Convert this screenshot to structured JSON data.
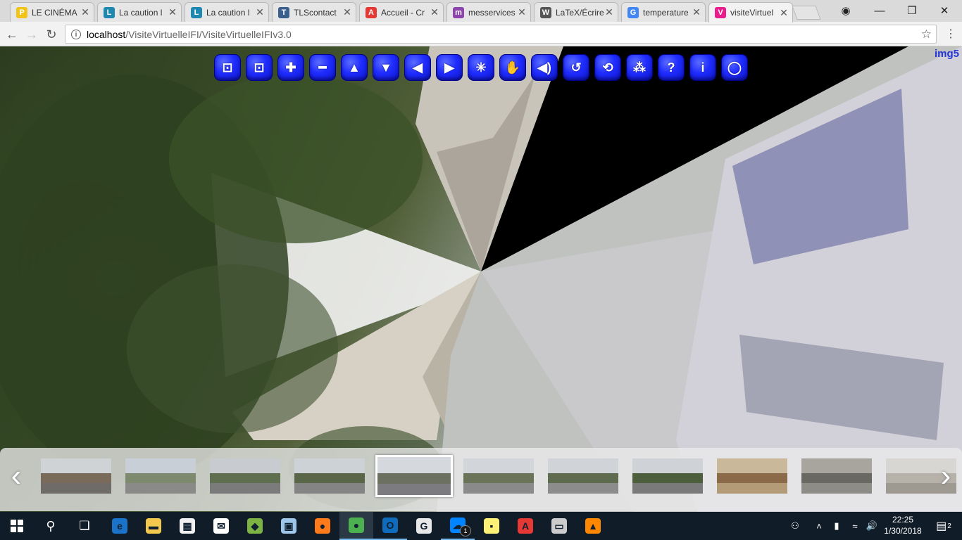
{
  "browser": {
    "tabs": [
      {
        "label": "LE CINÉMA",
        "icon": "p-logo-icon",
        "color": "#f0c419",
        "letter": "P"
      },
      {
        "label": "La caution l",
        "icon": "puzzle-icon",
        "color": "#1e88b0",
        "letter": "L"
      },
      {
        "label": "La caution l",
        "icon": "puzzle-icon",
        "color": "#1e88b0",
        "letter": "L"
      },
      {
        "label": "TLScontact",
        "icon": "t-logo-icon",
        "color": "#3a5f8c",
        "letter": "T"
      },
      {
        "label": "Accueil - Cr",
        "icon": "bank-logo-icon",
        "color": "#e53935",
        "letter": "A"
      },
      {
        "label": "messervices",
        "icon": "circles-logo-icon",
        "color": "#8e44ad",
        "letter": "m"
      },
      {
        "label": "LaTeX/Écrire",
        "icon": "book-icon",
        "color": "#555555",
        "letter": "W"
      },
      {
        "label": "temperature",
        "icon": "google-icon",
        "color": "#4285f4",
        "letter": "G"
      },
      {
        "label": "visiteVirtuel",
        "icon": "app-logo-icon",
        "color": "#e91e8c",
        "letter": "V",
        "active": true
      }
    ],
    "url_host": "localhost",
    "url_path": "/VisiteVirtuelleIFI/VisiteVirtuelleIFIv3.0"
  },
  "viewer": {
    "image_name": "img5",
    "controls": [
      {
        "name": "fullscreen-left-icon",
        "glyph": "⊡"
      },
      {
        "name": "fullscreen-right-icon",
        "glyph": "⊡"
      },
      {
        "name": "zoom-in-icon",
        "glyph": "✚"
      },
      {
        "name": "zoom-out-icon",
        "glyph": "━"
      },
      {
        "name": "arrow-up-icon",
        "glyph": "▲"
      },
      {
        "name": "arrow-down-icon",
        "glyph": "▼"
      },
      {
        "name": "arrow-left-icon",
        "glyph": "◀"
      },
      {
        "name": "arrow-right-icon",
        "glyph": "▶"
      },
      {
        "name": "gyroscope-icon",
        "glyph": "✳"
      },
      {
        "name": "hand-icon",
        "glyph": "✋"
      },
      {
        "name": "sound-icon",
        "glyph": "◀)"
      },
      {
        "name": "rotate-icon",
        "glyph": "↺"
      },
      {
        "name": "autorotate-icon",
        "glyph": "⟲"
      },
      {
        "name": "hotspots-icon",
        "glyph": "⁂"
      },
      {
        "name": "help-icon",
        "glyph": "?"
      },
      {
        "name": "info-icon",
        "glyph": "i"
      },
      {
        "name": "vr-icon",
        "glyph": "◯"
      }
    ],
    "thumbnails": [
      {
        "sky": "#cfd3d6",
        "mid": "#7a6a5a",
        "ground": "#6e6b68"
      },
      {
        "sky": "#c9cfd6",
        "mid": "#7e8a6e",
        "ground": "#8a8a88"
      },
      {
        "sky": "#c8ccd0",
        "mid": "#5f6e4f",
        "ground": "#7b7b7b"
      },
      {
        "sky": "#cdd2d6",
        "mid": "#596647",
        "ground": "#848484"
      },
      {
        "sky": "#d5d8dc",
        "mid": "#6c7060",
        "ground": "#7c7c80",
        "selected": true
      },
      {
        "sky": "#d2d6da",
        "mid": "#6b7358",
        "ground": "#8a8a8a"
      },
      {
        "sky": "#d0d4d8",
        "mid": "#5f6b4f",
        "ground": "#8c8c8c"
      },
      {
        "sky": "#cfd3d7",
        "mid": "#4d5e3c",
        "ground": "#7a7a7a"
      },
      {
        "sky": "#c9b99a",
        "mid": "#8a6a48",
        "ground": "#b49b78"
      },
      {
        "sky": "#a7a59e",
        "mid": "#6a6862",
        "ground": "#8e8c86"
      },
      {
        "sky": "#d8d6d2",
        "mid": "#b6b2aa",
        "ground": "#9e9a92"
      }
    ]
  },
  "taskbar": {
    "apps": [
      {
        "name": "edge-icon",
        "color": "#1a73c8",
        "glyph": "e"
      },
      {
        "name": "file-explorer-icon",
        "color": "#f2c94c",
        "glyph": "▬"
      },
      {
        "name": "store-icon",
        "color": "#f0f0f0",
        "glyph": "▦"
      },
      {
        "name": "mail-icon",
        "color": "#ffffff",
        "glyph": "✉"
      },
      {
        "name": "bluestacks-icon",
        "color": "#7cb342",
        "glyph": "◆"
      },
      {
        "name": "photos-icon",
        "color": "#9ec6e8",
        "glyph": "▣"
      },
      {
        "name": "firefox-icon",
        "color": "#ff7a1a",
        "glyph": "●"
      },
      {
        "name": "chrome-icon",
        "color": "#4caf50",
        "glyph": "●"
      },
      {
        "name": "outlook-icon",
        "color": "#0f6cbd",
        "glyph": "O"
      },
      {
        "name": "grammarly-icon",
        "color": "#e8e8e8",
        "glyph": "G"
      },
      {
        "name": "messenger-icon",
        "color": "#0084ff",
        "glyph": "☁"
      },
      {
        "name": "sticky-notes-icon",
        "color": "#fff176",
        "glyph": "▪"
      },
      {
        "name": "acrobat-icon",
        "color": "#e53935",
        "glyph": "A"
      },
      {
        "name": "terminal-icon",
        "color": "#cccccc",
        "glyph": "▭"
      },
      {
        "name": "vlc-icon",
        "color": "#ff8800",
        "glyph": "▲"
      }
    ],
    "messenger_badge": "1",
    "time": "22:25",
    "date": "1/30/2018",
    "notification_count": "2"
  }
}
